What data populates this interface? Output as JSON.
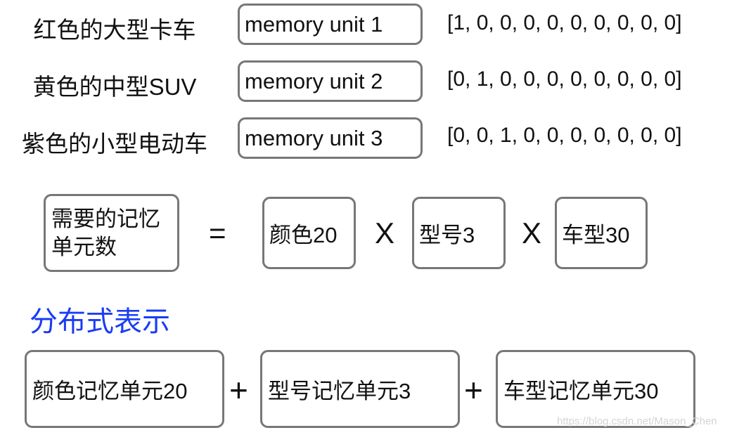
{
  "rows": [
    {
      "label": "红色的大型卡车",
      "unit": "memory unit 1",
      "vector": "[1, 0, 0, 0, 0, 0, 0, 0, 0, 0]"
    },
    {
      "label": "黄色的中型SUV",
      "unit": "memory unit 2",
      "vector": "[0, 1, 0, 0, 0, 0, 0, 0, 0, 0]"
    },
    {
      "label": "紫色的小型电动车",
      "unit": "memory unit 3",
      "vector": "[0, 0, 1, 0, 0, 0, 0, 0, 0, 0]"
    }
  ],
  "equation": {
    "lhs": "需要的记忆单元数",
    "equals": "=",
    "factors": [
      "颜色20",
      "型号3",
      "车型30"
    ],
    "times": "X"
  },
  "distributed": {
    "title": "分布式表示",
    "title_color": "#1a3cf5",
    "terms": [
      "颜色记忆单元20",
      "型号记忆单元3",
      "车型记忆单元30"
    ],
    "plus": "+"
  },
  "watermark": "https://blog.csdn.net/Mason_Chen"
}
